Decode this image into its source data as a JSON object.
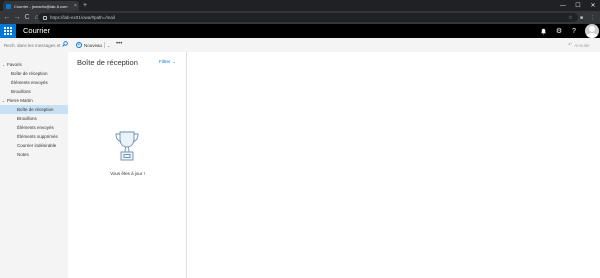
{
  "browser": {
    "tab_title": "Courrier - jsmartin@lab-lt.com",
    "tab_close": "×",
    "new_tab": "+",
    "window_controls": {
      "minimize": "—",
      "maximize": "☐",
      "close": "✕"
    },
    "nav": {
      "back": "←",
      "forward": "→",
      "reload": "C",
      "home": "⌂"
    },
    "url": "https://lab-ex01/owa/#path=/mail",
    "toolbar_icons": {
      "star": "☆",
      "extension": "■",
      "menu": "⋮"
    }
  },
  "app": {
    "name": "Courrier",
    "header_icons": {
      "notifications": "🔔",
      "settings": "⚙",
      "help": "?"
    }
  },
  "command_bar": {
    "search_placeholder": "Rech. dans les messages et",
    "new_label": "Nouveau",
    "new_chevron": "⌄",
    "more": "•••",
    "undo_label": "Annuler",
    "undo_icon": "↶"
  },
  "folders": {
    "favorites": {
      "label": "Favoris",
      "caret": "⌄",
      "items": [
        "Boîte de réception",
        "Éléments envoyés",
        "Brouillons"
      ]
    },
    "account": {
      "label": "Pierre Martin",
      "caret": "⌄",
      "items": [
        "Boîte de réception",
        "Brouillons",
        "Éléments envoyés",
        "Éléments supprimés",
        "Courrier indésirable",
        "Notes"
      ],
      "selected_index": 0
    }
  },
  "message_list": {
    "title": "Boîte de réception",
    "filter_label": "Filtrer",
    "filter_chevron": "⌄",
    "empty_message": "Vous êtes à jour !"
  },
  "colors": {
    "accent": "#0078d4",
    "header_bg": "#000000",
    "selected_folder": "#c7e0f4",
    "pane_bg": "#f4f4f4"
  }
}
